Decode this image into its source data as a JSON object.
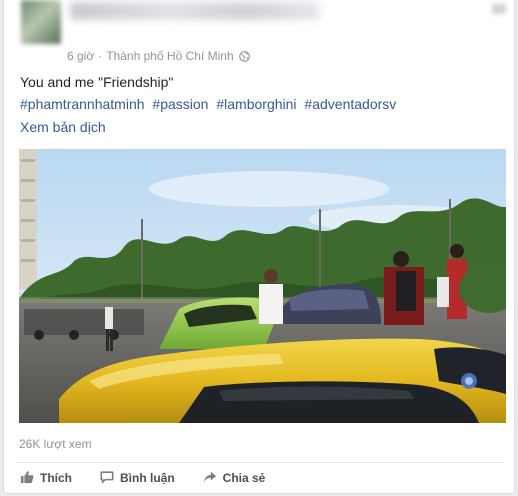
{
  "post": {
    "meta": {
      "time": "6 giờ",
      "separator": "·",
      "location": "Thành phố Hồ Chí Minh",
      "privacy_icon": "globe-icon"
    },
    "text": "You and me \"Friendship\"",
    "hashtags": [
      "#phamtrannhatminh",
      "#passion",
      "#lamborghini",
      "#adventadorsv"
    ],
    "translate_label": "Xem bản dịch",
    "views": "26K lượt xem"
  },
  "actions": [
    {
      "label": "Thích",
      "icon": "like-icon"
    },
    {
      "label": "Bình luận",
      "icon": "comment-icon"
    },
    {
      "label": "Chia sẻ",
      "icon": "share-icon"
    }
  ],
  "colors": {
    "link": "#365899",
    "meta_text": "#90949c",
    "action_text": "#4b4f56"
  }
}
